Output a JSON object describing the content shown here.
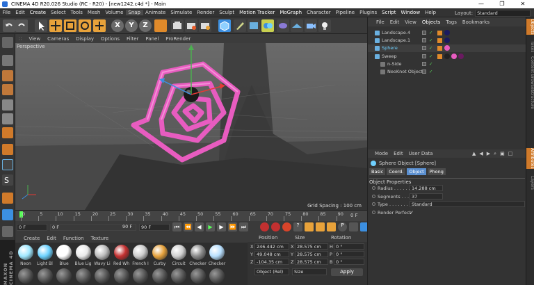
{
  "window": {
    "title": "CINEMA 4D R20.026 Studio (RC - R20) - [new1242.c4d *] - Main",
    "minimize": "—",
    "maximize": "❐",
    "close": "✕"
  },
  "menu": [
    "File",
    "Edit",
    "Create",
    "Select",
    "Tools",
    "Mesh",
    "Volume",
    "Snap",
    "Animate",
    "Simulate",
    "Render",
    "Sculpt",
    "Motion Tracker",
    "MoGraph",
    "Character",
    "Pipeline",
    "Plugins",
    "Script",
    "Window",
    "Help"
  ],
  "layout": {
    "label": "Layout:",
    "value": "Standard"
  },
  "viewport": {
    "menu": [
      "View",
      "Cameras",
      "Display",
      "Options",
      "Filter",
      "Panel",
      "ProRender"
    ],
    "camera_label": "Perspective",
    "grid_spacing": "Grid Spacing : 100 cm"
  },
  "timeline": {
    "ticks": [
      "0",
      "5",
      "10",
      "15",
      "20",
      "25",
      "30",
      "35",
      "40",
      "45",
      "50",
      "55",
      "60",
      "65",
      "70",
      "75",
      "80",
      "85",
      "90"
    ],
    "end_label": "0 F"
  },
  "transport": {
    "start": "0 F",
    "current": "0 F",
    "end_field": "90 F",
    "end2": "90 F"
  },
  "materials": {
    "menu": [
      "Create",
      "Edit",
      "Function",
      "Texture"
    ],
    "items": [
      {
        "label": "Neon",
        "color": "#9fe8ff"
      },
      {
        "label": "Light Bl",
        "color": "#6cd2ff"
      },
      {
        "label": "Blue",
        "color": "#ffffff"
      },
      {
        "label": "Blue Lig",
        "color": "#eaeaea"
      },
      {
        "label": "Wavy Li",
        "color": "#bdbdbd"
      },
      {
        "label": "Red Wh",
        "color": "#c43030"
      },
      {
        "label": "French I",
        "color": "#cccccc"
      },
      {
        "label": "Curby",
        "color": "#e6a23c"
      },
      {
        "label": "Circuit",
        "color": "#d0d0d0"
      },
      {
        "label": "Checker",
        "color": "#8a8a8a"
      },
      {
        "label": "Checker",
        "color": "#b8e0ff"
      }
    ]
  },
  "coords": {
    "headers": [
      "Position",
      "Size",
      "Rotation"
    ],
    "rows": [
      {
        "axis": "X",
        "pos": "246.442 cm",
        "saxis": "X",
        "size": "28.575 cm",
        "raxis": "H",
        "rot": "0 °"
      },
      {
        "axis": "Y",
        "pos": "49.048 cm",
        "saxis": "Y",
        "size": "28.575 cm",
        "raxis": "P",
        "rot": "0 °"
      },
      {
        "axis": "Z",
        "pos": "-104.35 cm",
        "saxis": "Z",
        "size": "28.575 cm",
        "raxis": "B",
        "rot": "0 °"
      }
    ],
    "mode": "Object (Rel)",
    "size_mode": "Size",
    "apply": "Apply"
  },
  "objects": {
    "tabs": [
      "File",
      "Edit",
      "View",
      "Objects",
      "Tags",
      "Bookmarks"
    ],
    "items": [
      {
        "name": "Landscape.4",
        "indent": 0,
        "color": "#ccc"
      },
      {
        "name": "Landscape.1",
        "indent": 0,
        "color": "#ccc"
      },
      {
        "name": "Sphere",
        "indent": 0,
        "color": "#6fd0ff"
      },
      {
        "name": "Sweep",
        "indent": 0,
        "color": "#ccc"
      },
      {
        "name": "n-Side",
        "indent": 1,
        "color": "#ccc"
      },
      {
        "name": "NeoKnot Object",
        "indent": 1,
        "color": "#ccc"
      }
    ]
  },
  "attributes": {
    "menu": [
      "Mode",
      "Edit",
      "User Data"
    ],
    "header": "Sphere Object [Sphere]",
    "tabs": [
      "Basic",
      "Coord.",
      "Object",
      "Phong"
    ],
    "section": "Object Properties",
    "props": [
      {
        "label": "Radius . . . . . . . .",
        "value": "14.288 cm"
      },
      {
        "label": "Segments . . . . .",
        "value": "37"
      },
      {
        "label": "Type . . . . . . . .",
        "value": "Standard"
      },
      {
        "label": "Render Perfect",
        "value": "✓"
      }
    ]
  },
  "right_tabs": [
    "Objects",
    "Takes",
    "Content Browser",
    "Structure",
    "Attributes",
    "Layers"
  ],
  "brand": "MAXON CINEMA 4D",
  "colors": {
    "accent": "#5fa8ff",
    "pink": "#e85cc0",
    "panel": "#333333"
  }
}
